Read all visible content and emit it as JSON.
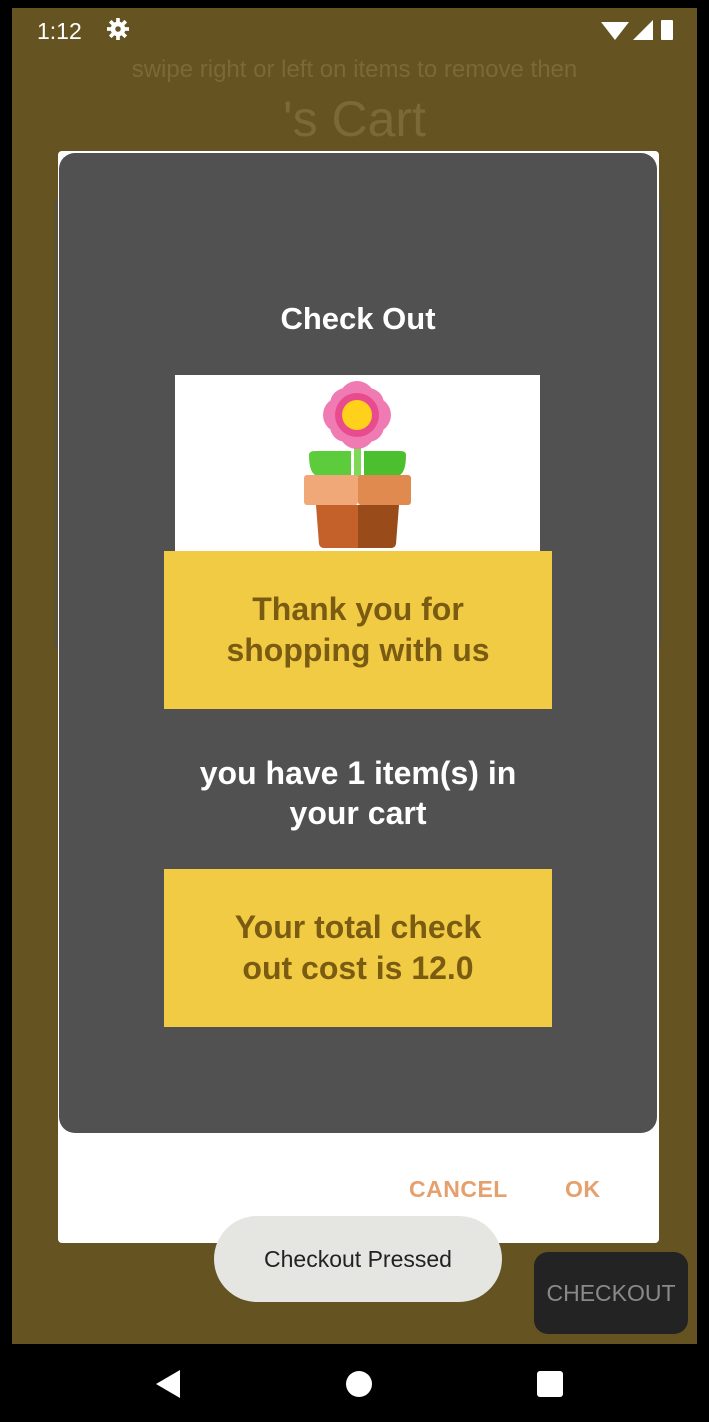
{
  "status_bar": {
    "time": "1:12"
  },
  "header": {
    "hint": "swipe right or left on items to remove then",
    "title": "'s Cart"
  },
  "dialog": {
    "title": "Check Out",
    "thanks_message": "Thank you for shopping with us",
    "items_message": "you have 1 item(s) in your cart",
    "total_message": "Your total check out cost is 12.0",
    "cancel_label": "CANCEL",
    "ok_label": "OK"
  },
  "toast": {
    "text": "Checkout Pressed"
  },
  "checkout_button": {
    "label": "CHECKOUT"
  },
  "icons": {
    "settings": "gear-icon",
    "wifi": "wifi-icon",
    "signal": "signal-icon",
    "battery": "battery-icon",
    "product_image": "flower-pot-icon",
    "nav_back": "back-triangle-icon",
    "nav_home": "home-circle-icon",
    "nav_recents": "recents-square-icon"
  },
  "colors": {
    "background": "#655321",
    "panel": "#515151",
    "accent_yellow": "#f2cb45",
    "button_text": "#e5a06e"
  }
}
